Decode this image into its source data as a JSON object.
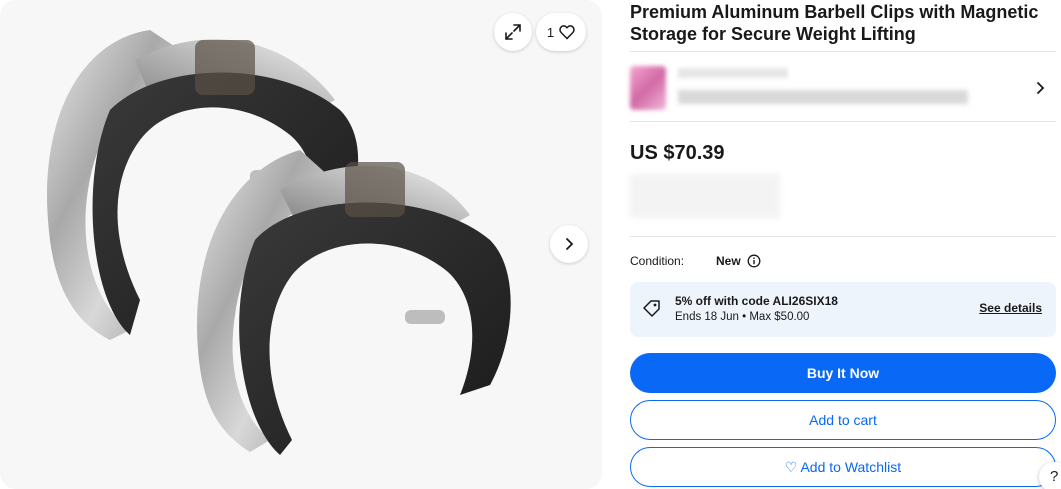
{
  "gallery": {
    "image_alt": "Premium Aluminum Barbell Clips",
    "favorite_count": "1",
    "icons": [
      "expand-icon",
      "heart-icon",
      "chevron-right-icon"
    ]
  },
  "product": {
    "title": "Premium Aluminum Barbell Clips with Magnetic Storage for Secure Weight Lifting",
    "price": "US $70.39"
  },
  "condition": {
    "label": "Condition:",
    "value": "New"
  },
  "promo": {
    "line1": "5% off with code ALI26SIX18",
    "line2": "Ends 18 Jun • Max $50.00",
    "link": "See details"
  },
  "actions": {
    "buy_now": "Buy It Now",
    "add_to_cart": "Add to cart",
    "watchlist": "Add to Watchlist",
    "watchlist_heart": "♡"
  },
  "help": {
    "label": "?"
  },
  "colors": {
    "accent": "#0968f6",
    "promo_bg": "#eef4fb",
    "gallery_bg": "#f7f7f7"
  }
}
